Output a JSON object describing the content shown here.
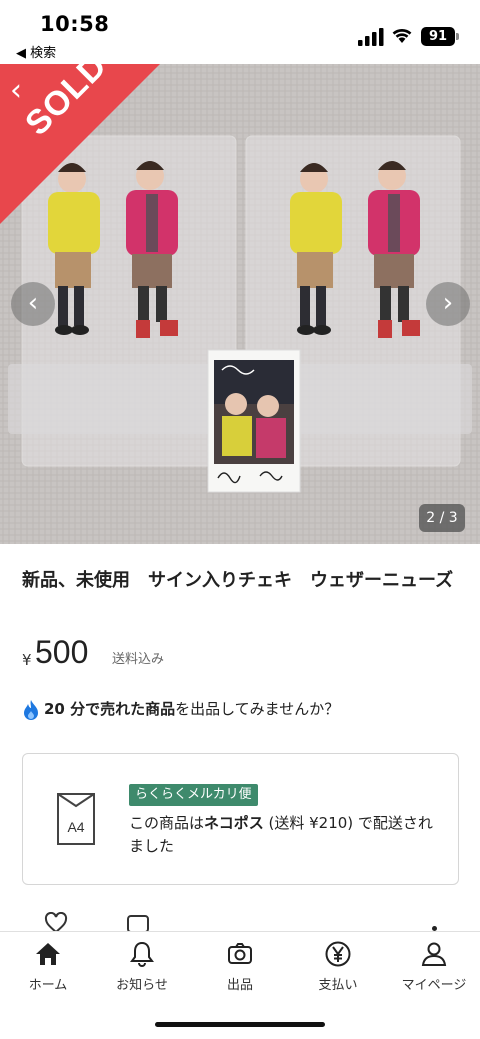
{
  "status": {
    "time": "10:58",
    "back_label": "◀ 検索",
    "battery": "91"
  },
  "hero": {
    "sold_label": "SOLD",
    "page_indicator": "2 / 3"
  },
  "product": {
    "title": "新品、未使用　サイン入りチェキ　ウェザーニューズ",
    "currency": "¥",
    "price": "500",
    "shipping_included": "送料込み"
  },
  "promo": {
    "highlight": "20 分で売れた商品",
    "rest": "を出品してみませんか？"
  },
  "shipping": {
    "badge": "らくらくメルカリ便",
    "text_prefix": "この商品は",
    "method": "ネコポス",
    "text_suffix": " (送料 ¥210) で配送されました",
    "size_label": "A4"
  },
  "nav": [
    {
      "label": "ホーム",
      "icon": "home-icon"
    },
    {
      "label": "お知らせ",
      "icon": "bell-icon"
    },
    {
      "label": "出品",
      "icon": "camera-icon"
    },
    {
      "label": "支払い",
      "icon": "yen-icon"
    },
    {
      "label": "マイページ",
      "icon": "person-icon"
    }
  ]
}
